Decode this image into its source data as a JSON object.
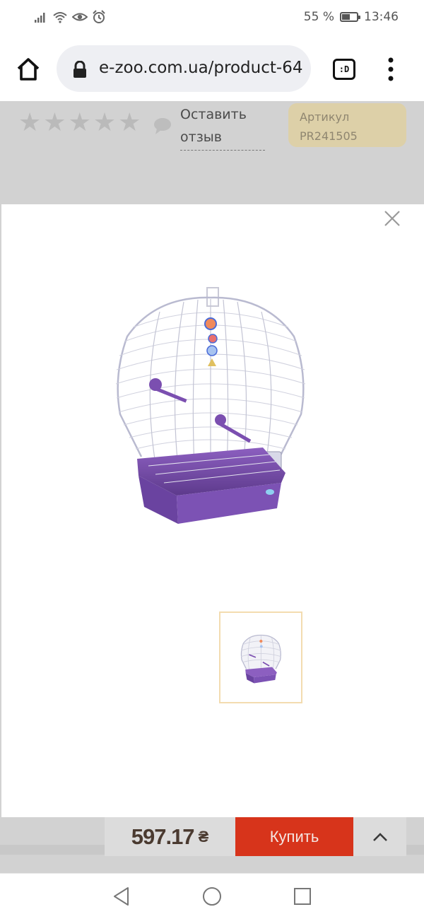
{
  "status_bar": {
    "battery_percent": "55 %",
    "battery_level": 0.55,
    "time": "13:46",
    "icons": [
      "signal-icon",
      "wifi-icon",
      "eye-comfort-icon",
      "alarm-icon",
      "battery-icon"
    ]
  },
  "browser": {
    "url": "e-zoo.com.ua/product-64",
    "tab_switcher_label": ":D",
    "icons": [
      "home-icon",
      "lock-icon",
      "overflow-menu-icon"
    ]
  },
  "product": {
    "rating_stars": 5,
    "rating_value": 0,
    "review_link": "Оставить отзыв",
    "sku_label": "Артикул",
    "sku_value": "PR241505"
  },
  "gallery": {
    "images": [
      "product-photo",
      "thumbnail"
    ],
    "icons": [
      "close-icon"
    ]
  },
  "buy_bar": {
    "price": "597.17",
    "currency": "₴",
    "buy_label": "Купить",
    "icons": [
      "chevron-up-icon"
    ]
  },
  "system_nav": {
    "icons": [
      "back-icon",
      "home-circle-icon",
      "recents-icon"
    ]
  },
  "colors": {
    "buy_button": "#d7341b",
    "sku_badge": "#ddd0a8",
    "overlay": "#d2d2d2",
    "cage_base": "#7b4fb0"
  }
}
